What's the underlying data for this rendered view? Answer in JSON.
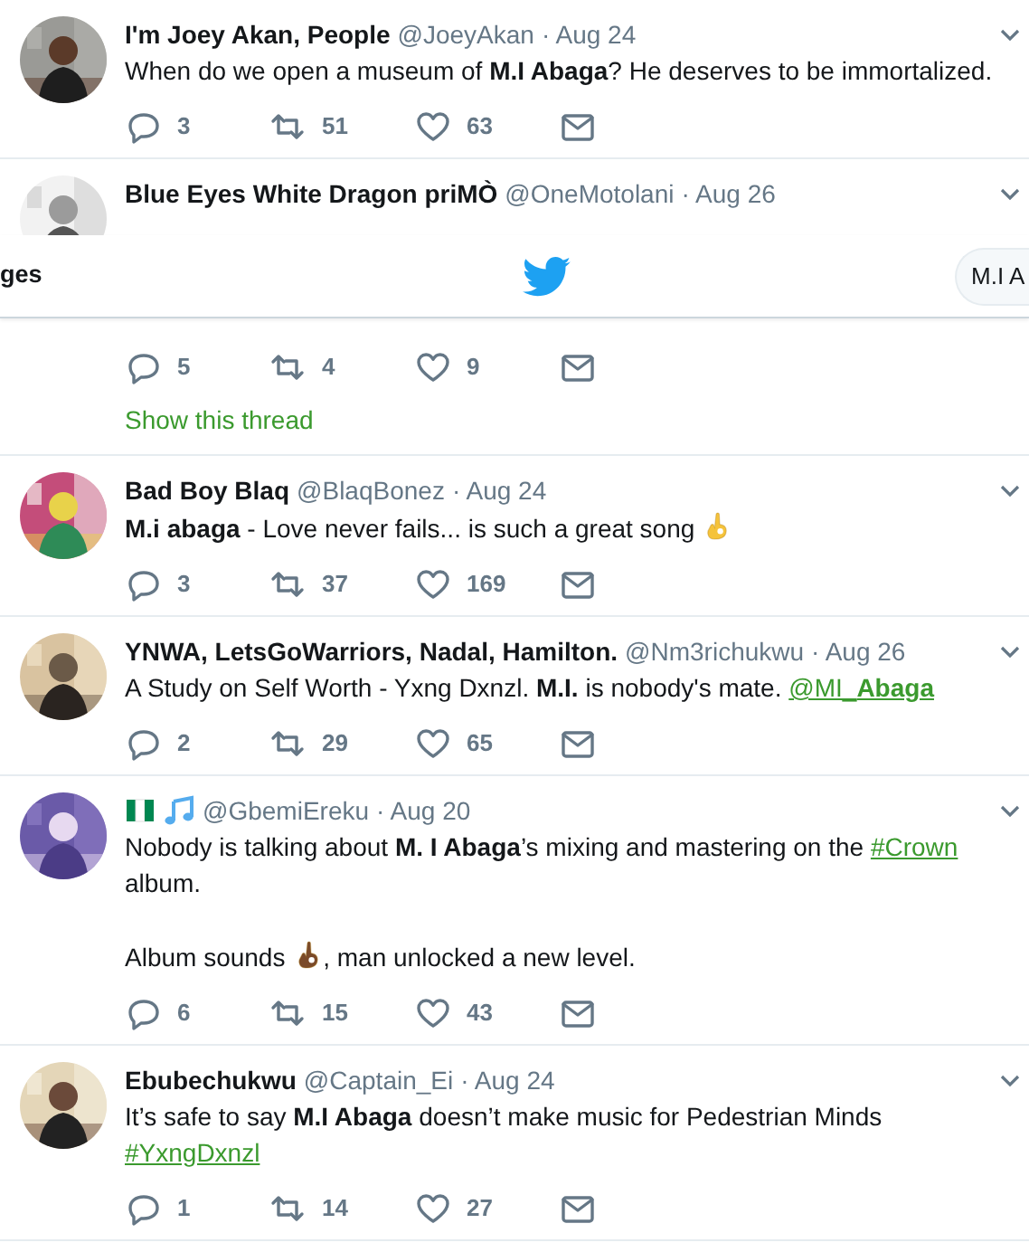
{
  "tweets": [
    {
      "name": "I'm Joey Akan, People",
      "handle": "@JoeyAkan",
      "date": "· Aug 24",
      "avatar": {
        "kind": "picture"
      },
      "lines": [
        {
          "segments": [
            {
              "kind": "text",
              "text": "When do we open a museum of **M.I Abaga**? He deserves to be immortalized."
            }
          ]
        }
      ],
      "stats": {
        "replies": "3",
        "retweets": "51",
        "likes": "63"
      }
    },
    {
      "name": "Blue Eyes White Dragon priMÒ",
      "handle": "@OneMotolani",
      "date": "· Aug 26",
      "avatar": {
        "kind": "picture"
      },
      "covered_by_header": true,
      "stats": {
        "replies": "5",
        "retweets": "4",
        "likes": "9"
      },
      "thread_link": "Show this thread"
    },
    {
      "name": "Bad Boy Blaq",
      "handle": "@BlaqBonez",
      "date": "· Aug 24",
      "avatar": {
        "kind": "picture"
      },
      "lines": [
        {
          "segments": [
            {
              "kind": "text",
              "text": "**M.i abaga** - Love never fails... is such a great song "
            },
            {
              "kind": "emoji",
              "color": "#f5c33b"
            }
          ]
        }
      ],
      "stats": {
        "replies": "3",
        "retweets": "37",
        "likes": "169"
      }
    },
    {
      "name": "YNWA, LetsGoWarriors, Nadal, Hamilton.",
      "handle": "@Nm3richukwu",
      "date": "· Aug 26",
      "avatar": {
        "kind": "picture"
      },
      "lines": [
        {
          "segments": [
            {
              "kind": "text",
              "text": "A Study on Self Worth - Yxng Dxnzl. **M.I.** is nobody's mate. "
            },
            {
              "kind": "mention",
              "text": "@MI_**Abaga**"
            }
          ]
        }
      ],
      "stats": {
        "replies": "2",
        "retweets": "29",
        "likes": "65"
      }
    },
    {
      "name_emojis": [
        {
          "kind": "flag"
        },
        {
          "kind": "music-note"
        }
      ],
      "handle": "@GbemiEreku",
      "date": "· Aug 20",
      "avatar": {
        "kind": "picture"
      },
      "lines": [
        {
          "segments": [
            {
              "kind": "text",
              "text": "Nobody is talking about **M. I Abaga**’s mixing and mastering on the "
            },
            {
              "kind": "hashtag",
              "text": "#Crown"
            }
          ]
        },
        {
          "segments": [
            {
              "kind": "text",
              "text": "album."
            }
          ]
        },
        {
          "gap_before": true,
          "segments": [
            {
              "kind": "text",
              "text": "Album sounds "
            },
            {
              "kind": "emoji",
              "color": "#7a4a2a"
            },
            {
              "kind": "text",
              "text": ", man unlocked a new level."
            }
          ]
        }
      ],
      "stats": {
        "replies": "6",
        "retweets": "15",
        "likes": "43"
      }
    },
    {
      "name": "Ebubechukwu",
      "handle": "@Captain_Ei",
      "date": "· Aug 24",
      "avatar": {
        "kind": "picture"
      },
      "lines": [
        {
          "segments": [
            {
              "kind": "text",
              "text": "It’s safe to say **M.I Abaga** doesn’t make music for Pedestrian Minds"
            }
          ]
        },
        {
          "segments": [
            {
              "kind": "hashtag",
              "text": "#YxngDxnzl"
            }
          ]
        }
      ],
      "stats": {
        "replies": "1",
        "retweets": "14",
        "likes": "27"
      }
    }
  ],
  "header": {
    "tab_label": "ges",
    "search": {
      "value": "M.I A"
    }
  }
}
